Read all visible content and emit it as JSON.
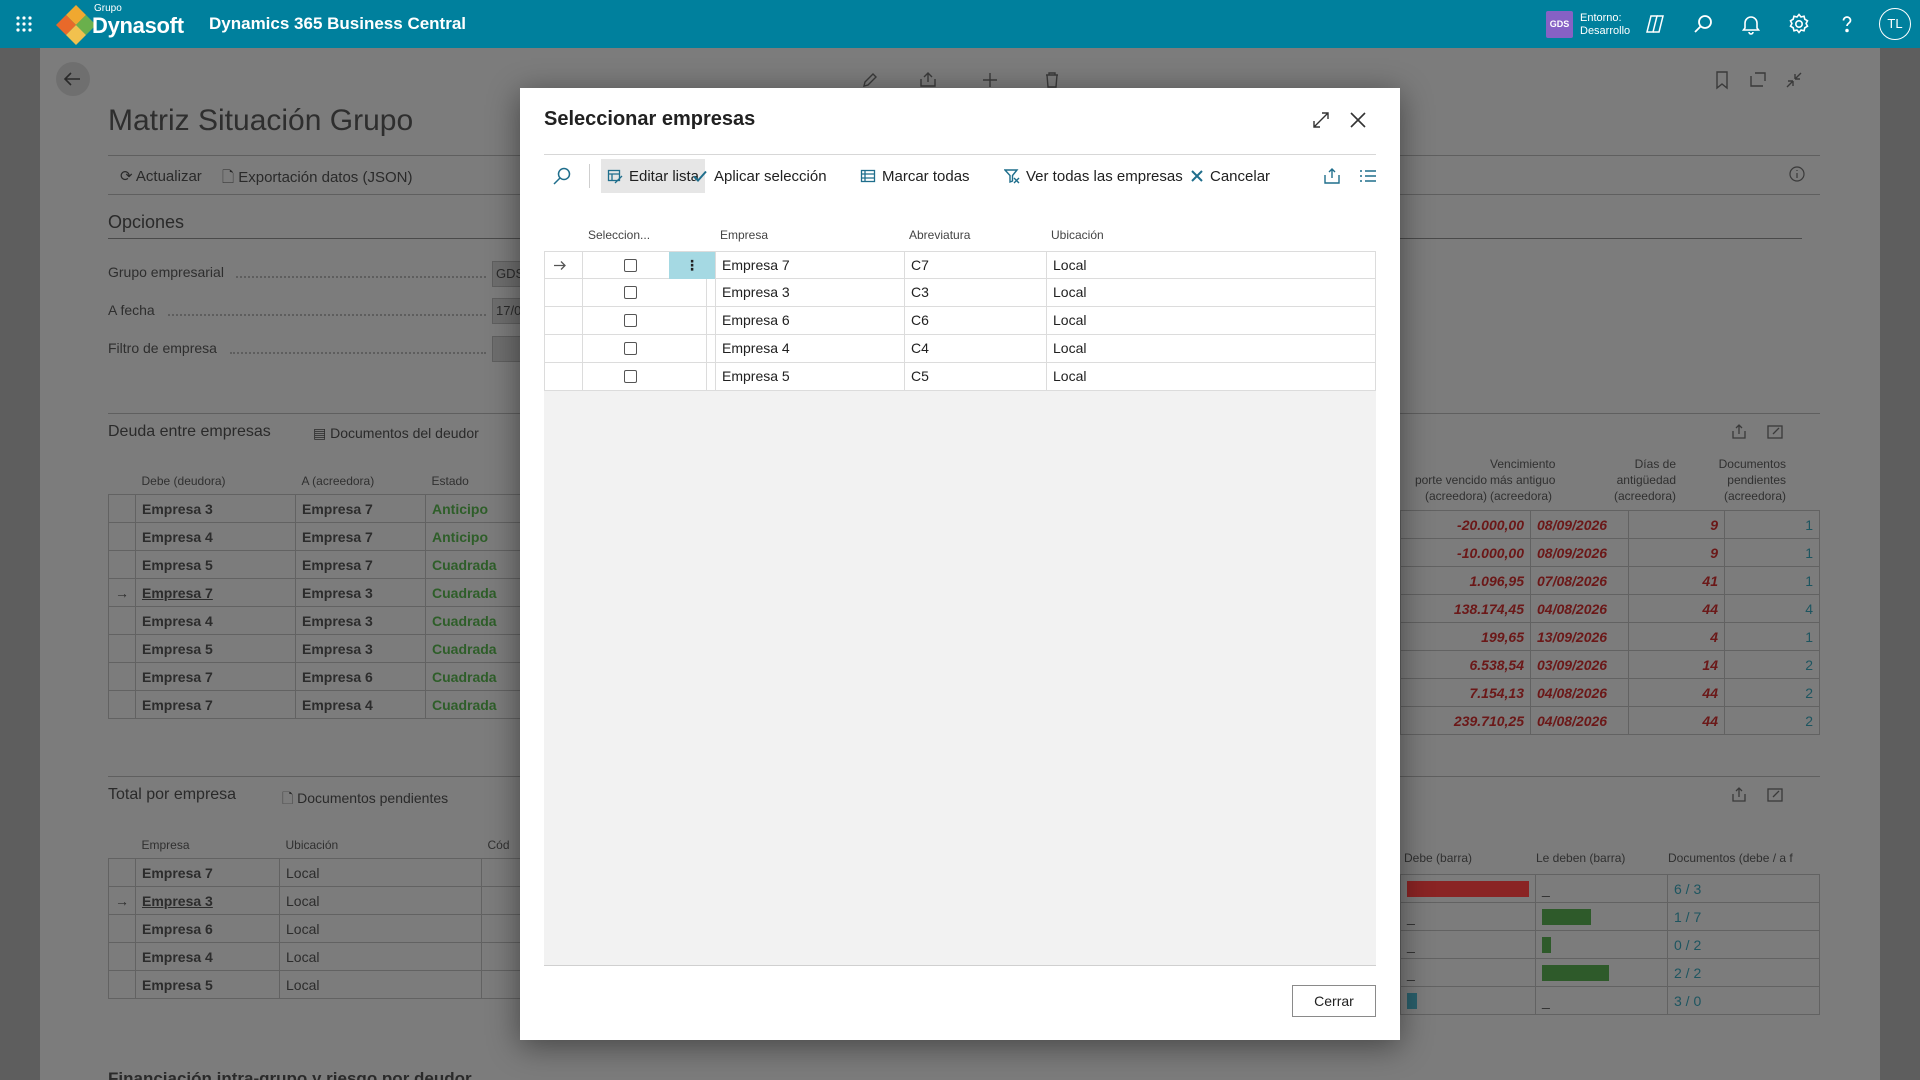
{
  "topbar": {
    "logo_small": "Grupo",
    "logo_brand": "Dynasoft",
    "app_name": "Dynamics 365 Business Central",
    "env_badge": "GDS",
    "env_line1": "Entorno:",
    "env_line2": "Desarrollo",
    "avatar": "TL",
    "bg_color": "#00809d"
  },
  "page": {
    "title": "Matriz Situación Grupo",
    "actions": [
      "Actualizar",
      "Exportación datos (JSON)"
    ],
    "options_heading": "Opciones",
    "fields": [
      {
        "label": "Grupo empresarial",
        "value": "GDS"
      },
      {
        "label": "A fecha",
        "value": "17/0"
      },
      {
        "label": "Filtro de empresa",
        "value": ""
      }
    ],
    "debt_section": {
      "heading": "Deuda entre empresas",
      "action": "Documentos del deudor",
      "columns": [
        "Debe (deudora)",
        "A (acreedora)",
        "Estado"
      ],
      "right_columns": [
        "porte vencido (acreedora)",
        "Vencimiento más antiguo (acreedora)",
        "Días de antigüedad (acreedora)",
        "Documentos pendientes (acreedora)"
      ],
      "rows": [
        {
          "debe": "Empresa 3",
          "a": "Empresa 7",
          "estado": "Anticipo",
          "importe": "-20.000,00",
          "venc": "08/09/2026",
          "dias": "9",
          "docs": "1"
        },
        {
          "debe": "Empresa 4",
          "a": "Empresa 7",
          "estado": "Anticipo",
          "importe": "-10.000,00",
          "venc": "08/09/2026",
          "dias": "9",
          "docs": "1"
        },
        {
          "debe": "Empresa 5",
          "a": "Empresa 7",
          "estado": "Cuadrada",
          "importe": "1.096,95",
          "venc": "07/08/2026",
          "dias": "41",
          "docs": "1"
        },
        {
          "debe": "Empresa 7",
          "a": "Empresa 3",
          "estado": "Cuadrada",
          "importe": "138.174,45",
          "venc": "04/08/2026",
          "dias": "44",
          "docs": "4"
        },
        {
          "debe": "Empresa 4",
          "a": "Empresa 3",
          "estado": "Cuadrada",
          "importe": "199,65",
          "venc": "13/09/2026",
          "dias": "4",
          "docs": "1"
        },
        {
          "debe": "Empresa 5",
          "a": "Empresa 3",
          "estado": "Cuadrada",
          "importe": "6.538,54",
          "venc": "03/09/2026",
          "dias": "14",
          "docs": "2"
        },
        {
          "debe": "Empresa 7",
          "a": "Empresa 6",
          "estado": "Cuadrada",
          "importe": "7.154,13",
          "venc": "04/08/2026",
          "dias": "44",
          "docs": "2"
        },
        {
          "debe": "Empresa 7",
          "a": "Empresa 4",
          "estado": "Cuadrada",
          "importe": "239.710,25",
          "venc": "04/08/2026",
          "dias": "44",
          "docs": "2"
        }
      ]
    },
    "total_section": {
      "heading": "Total por empresa",
      "action": "Documentos pendientes",
      "columns": [
        "Empresa",
        "Ubicación",
        "Cód"
      ],
      "right_columns": [
        "Debe (barra)",
        "Le deben (barra)",
        "Documentos (debe / a f"
      ],
      "rows": [
        {
          "empresa": "Empresa 7",
          "ubic": "Local",
          "debe_bar": 0.95,
          "deben_bar": 0,
          "docs": "6 / 3"
        },
        {
          "empresa": "Empresa 3",
          "ubic": "Local",
          "debe_bar": 0,
          "deben_bar": 0.38,
          "docs": "1 / 7"
        },
        {
          "empresa": "Empresa 6",
          "ubic": "Local",
          "debe_bar": 0,
          "deben_bar": 0.07,
          "docs": "0 / 2"
        },
        {
          "empresa": "Empresa 4",
          "ubic": "Local",
          "debe_bar": 0,
          "deben_bar": 0.52,
          "docs": "2 / 2"
        },
        {
          "empresa": "Empresa 5",
          "ubic": "Local",
          "debe_bar": 0.08,
          "deben_bar": 0,
          "docs": "3 / 0"
        }
      ],
      "underscore": "_"
    },
    "bottom_heading": "Financiación intra-grupo y riesgo por deudor"
  },
  "modal": {
    "title": "Seleccionar empresas",
    "toolbar": {
      "edit_list": "Editar lista",
      "apply": "Aplicar selección",
      "mark_all": "Marcar todas",
      "see_all": "Ver todas las empresas",
      "cancel": "Cancelar"
    },
    "columns": {
      "select": "Seleccion...",
      "company": "Empresa",
      "abbr": "Abreviatura",
      "location": "Ubicación"
    },
    "rows": [
      {
        "company": "Empresa 7",
        "abbr": "C7",
        "location": "Local",
        "checked": false
      },
      {
        "company": "Empresa 3",
        "abbr": "C3",
        "location": "Local",
        "checked": false
      },
      {
        "company": "Empresa 6",
        "abbr": "C6",
        "location": "Local",
        "checked": false
      },
      {
        "company": "Empresa 4",
        "abbr": "C4",
        "location": "Local",
        "checked": false
      },
      {
        "company": "Empresa 5",
        "abbr": "C5",
        "location": "Local",
        "checked": false
      }
    ],
    "close_button": "Cerrar"
  }
}
